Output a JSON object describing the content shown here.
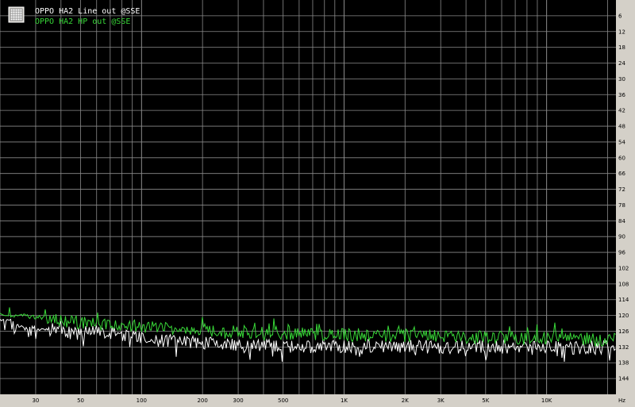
{
  "colors": {
    "frame": "#d4d0c8",
    "plot_bg": "#000000",
    "grid": "#8a8a8a",
    "series_white": "#ffffff",
    "series_green": "#38d838"
  },
  "legend": {
    "icon": "grid-icon",
    "items": [
      {
        "label": "OPPO HA2 Line out @SSE",
        "color": "#ffffff"
      },
      {
        "label": "OPPO HA2 HP out @SSE",
        "color": "#38d838"
      }
    ]
  },
  "chart_data": {
    "type": "line",
    "title": "",
    "xlabel": "",
    "ylabel": "",
    "x_unit": "Hz",
    "xscale": "log",
    "xlim": [
      20,
      22000
    ],
    "ylim": [
      0,
      150
    ],
    "y_inverted": true,
    "x_tick_labels": [
      {
        "v": 30,
        "t": "30"
      },
      {
        "v": 50,
        "t": "50"
      },
      {
        "v": 100,
        "t": "100"
      },
      {
        "v": 200,
        "t": "200"
      },
      {
        "v": 300,
        "t": "300"
      },
      {
        "v": 500,
        "t": "500"
      },
      {
        "v": 1000,
        "t": "1K"
      },
      {
        "v": 2000,
        "t": "2K"
      },
      {
        "v": 3000,
        "t": "3K"
      },
      {
        "v": 5000,
        "t": "5K"
      },
      {
        "v": 10000,
        "t": "10K"
      }
    ],
    "y_tick_labels": [
      6,
      12,
      18,
      24,
      30,
      36,
      42,
      48,
      54,
      60,
      66,
      72,
      78,
      84,
      90,
      96,
      102,
      108,
      114,
      120,
      126,
      132,
      138,
      144
    ],
    "series": [
      {
        "name": "OPPO HA2 Line out @SSE",
        "color": "#ffffff",
        "points": [
          [
            20,
            122
          ],
          [
            22,
            121.5
          ],
          [
            24,
            123
          ],
          [
            26,
            125
          ],
          [
            28,
            124.5
          ],
          [
            30,
            125
          ],
          [
            33,
            126
          ],
          [
            36,
            125.5
          ],
          [
            40,
            124.5
          ],
          [
            45,
            127
          ],
          [
            50,
            126
          ],
          [
            55,
            127
          ],
          [
            60,
            126.5
          ],
          [
            70,
            127
          ],
          [
            80,
            128
          ],
          [
            100,
            128.5
          ],
          [
            120,
            129.5
          ],
          [
            150,
            130
          ],
          [
            200,
            130.5
          ],
          [
            250,
            131
          ],
          [
            300,
            131.5
          ],
          [
            400,
            131.5
          ],
          [
            500,
            131.8
          ],
          [
            700,
            132
          ],
          [
            1000,
            132
          ],
          [
            1500,
            132
          ],
          [
            2000,
            132.2
          ],
          [
            3000,
            132.2
          ],
          [
            5000,
            132.2
          ],
          [
            7000,
            132.3
          ],
          [
            10000,
            132.3
          ],
          [
            15000,
            132.5
          ],
          [
            20000,
            132.5
          ]
        ]
      },
      {
        "name": "OPPO HA2 HP out @SSE",
        "color": "#38d838",
        "points": [
          [
            20,
            120
          ],
          [
            24,
            120
          ],
          [
            28,
            120.5
          ],
          [
            33,
            121
          ],
          [
            40,
            122
          ],
          [
            50,
            123
          ],
          [
            60,
            123.5
          ],
          [
            70,
            124
          ],
          [
            80,
            124
          ],
          [
            100,
            124.5
          ],
          [
            120,
            125
          ],
          [
            150,
            126
          ],
          [
            200,
            126
          ],
          [
            250,
            126.5
          ],
          [
            300,
            126.8
          ],
          [
            400,
            127
          ],
          [
            500,
            127
          ],
          [
            700,
            127.5
          ],
          [
            1000,
            127.5
          ],
          [
            1500,
            128
          ],
          [
            2000,
            128
          ],
          [
            3000,
            128.3
          ],
          [
            5000,
            128.5
          ],
          [
            7000,
            128.8
          ],
          [
            10000,
            129
          ],
          [
            15000,
            129.3
          ],
          [
            20000,
            129.5
          ]
        ]
      }
    ]
  }
}
